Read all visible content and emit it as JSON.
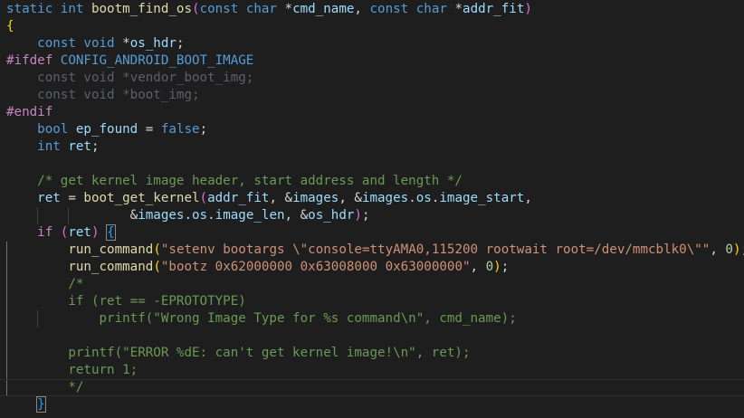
{
  "colors": {
    "background": "#1e1e1e",
    "keyword": "#569cd6",
    "function": "#dcdcaa",
    "identifier": "#9cdcfe",
    "plain": "#d4d4d4",
    "string": "#ce9178",
    "number": "#b5cea8",
    "preprocessor": "#c586c0",
    "comment": "#6a9955",
    "inactive": "#5b6068",
    "bracket_gold": "#ffd700",
    "bracket_purple": "#da70d6",
    "bracket_blue": "#179fff"
  },
  "lines": [
    [
      [
        "kw",
        "static "
      ],
      [
        "kw",
        "int "
      ],
      [
        "fn",
        "bootm_find_os"
      ],
      [
        "brp",
        "("
      ],
      [
        "kw",
        "const "
      ],
      [
        "kw",
        "char "
      ],
      [
        "pl",
        "*"
      ],
      [
        "id",
        "cmd_name"
      ],
      [
        "pl",
        ", "
      ],
      [
        "kw",
        "const "
      ],
      [
        "kw",
        "char "
      ],
      [
        "pl",
        "*"
      ],
      [
        "id",
        "addr_fit"
      ],
      [
        "brp",
        ")"
      ]
    ],
    [
      [
        "br",
        "{"
      ]
    ],
    [
      [
        "pl",
        "    "
      ],
      [
        "kw",
        "const "
      ],
      [
        "kw",
        "void "
      ],
      [
        "pl",
        "*"
      ],
      [
        "id",
        "os_hdr"
      ],
      [
        "pl",
        ";"
      ]
    ],
    [
      [
        "pp",
        "#ifdef "
      ],
      [
        "mac",
        "CONFIG_ANDROID_BOOT_IMAGE"
      ]
    ],
    [
      [
        "pl",
        "    "
      ],
      [
        "dim",
        "const void *vendor_boot_img;"
      ]
    ],
    [
      [
        "pl",
        "    "
      ],
      [
        "dim",
        "const void *boot_img;"
      ]
    ],
    [
      [
        "pp",
        "#endif"
      ]
    ],
    [
      [
        "pl",
        "    "
      ],
      [
        "kw",
        "bool "
      ],
      [
        "id",
        "ep_found"
      ],
      [
        "pl",
        " = "
      ],
      [
        "kw",
        "false"
      ],
      [
        "pl",
        ";"
      ]
    ],
    [
      [
        "pl",
        "    "
      ],
      [
        "kw",
        "int "
      ],
      [
        "id",
        "ret"
      ],
      [
        "pl",
        ";"
      ]
    ],
    [
      [
        "pl",
        ""
      ]
    ],
    [
      [
        "pl",
        "    "
      ],
      [
        "cm",
        "/* get kernel image header, start address and length */"
      ]
    ],
    [
      [
        "pl",
        "    "
      ],
      [
        "id",
        "ret"
      ],
      [
        "pl",
        " = "
      ],
      [
        "fn",
        "boot_get_kernel"
      ],
      [
        "brp",
        "("
      ],
      [
        "id",
        "addr_fit"
      ],
      [
        "pl",
        ", &"
      ],
      [
        "id",
        "images"
      ],
      [
        "pl",
        ", &"
      ],
      [
        "id",
        "images"
      ],
      [
        "pl",
        "."
      ],
      [
        "id",
        "os"
      ],
      [
        "pl",
        "."
      ],
      [
        "id",
        "image_start"
      ],
      [
        "pl",
        ","
      ]
    ],
    [
      [
        "pl",
        "                "
      ],
      [
        "pl",
        "&"
      ],
      [
        "id",
        "images"
      ],
      [
        "pl",
        "."
      ],
      [
        "id",
        "os"
      ],
      [
        "pl",
        "."
      ],
      [
        "id",
        "image_len"
      ],
      [
        "pl",
        ", &"
      ],
      [
        "id",
        "os_hdr"
      ],
      [
        "brp",
        ")"
      ],
      [
        "pl",
        ";"
      ]
    ],
    [
      [
        "pl",
        "    "
      ],
      [
        "pp",
        "if "
      ],
      [
        "brp",
        "("
      ],
      [
        "id",
        "ret"
      ],
      [
        "brp",
        ")"
      ],
      [
        "pl",
        " "
      ],
      [
        "brb",
        "{"
      ]
    ],
    [
      [
        "pl",
        "        "
      ],
      [
        "fn",
        "run_command"
      ],
      [
        "br",
        "("
      ],
      [
        "str",
        "\"setenv bootargs \\\"console=ttyAMA0,115200 rootwait root=/dev/mmcblk0\\\"\""
      ],
      [
        "pl",
        ", "
      ],
      [
        "num",
        "0"
      ],
      [
        "br",
        ")"
      ],
      [
        "pl",
        ";"
      ]
    ],
    [
      [
        "pl",
        "        "
      ],
      [
        "fn",
        "run_command"
      ],
      [
        "br",
        "("
      ],
      [
        "str",
        "\"bootz 0x62000000 0x63008000 0x63000000\""
      ],
      [
        "pl",
        ", "
      ],
      [
        "num",
        "0"
      ],
      [
        "br",
        ")"
      ],
      [
        "pl",
        ";"
      ]
    ],
    [
      [
        "pl",
        "        "
      ],
      [
        "cm",
        "/*"
      ]
    ],
    [
      [
        "pl",
        "        "
      ],
      [
        "cm",
        "if (ret == -EPROTOTYPE)"
      ]
    ],
    [
      [
        "pl",
        "            "
      ],
      [
        "cm",
        "printf(\"Wrong Image Type for %s command\\n\", cmd_name);"
      ]
    ],
    [
      [
        "pl",
        ""
      ]
    ],
    [
      [
        "pl",
        "        "
      ],
      [
        "cm",
        "printf(\"ERROR %dE: can't get kernel image!\\n\", ret);"
      ]
    ],
    [
      [
        "pl",
        "        "
      ],
      [
        "cm",
        "return 1;"
      ]
    ],
    [
      [
        "pl",
        "        "
      ],
      [
        "cm",
        "*/"
      ]
    ],
    [
      [
        "pl",
        "    "
      ],
      [
        "brb",
        "}"
      ]
    ],
    [
      [
        "pl",
        "        "
      ],
      [
        "id",
        "..."
      ]
    ]
  ],
  "cursor_line": 22
}
